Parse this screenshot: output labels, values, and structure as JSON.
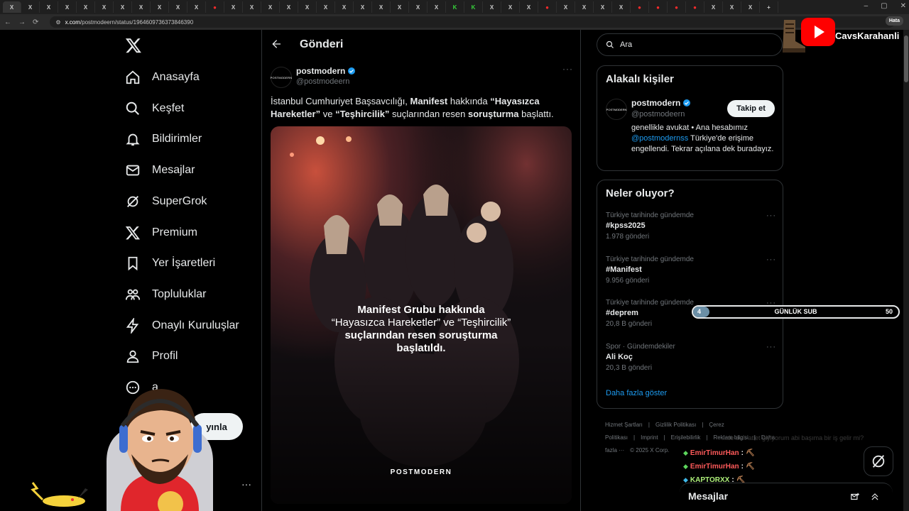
{
  "browser": {
    "url_host": "x.com",
    "url_path": "/postmodeern/status/1964609736373846390",
    "error_badge": "Hata"
  },
  "nav": {
    "items": [
      {
        "label": "Anasayfa",
        "icon": "home-icon"
      },
      {
        "label": "Keşfet",
        "icon": "search-icon"
      },
      {
        "label": "Bildirimler",
        "icon": "bell-icon"
      },
      {
        "label": "Mesajlar",
        "icon": "mail-icon"
      },
      {
        "label": "SuperGrok",
        "icon": "grok-icon"
      },
      {
        "label": "Premium",
        "icon": "x-icon"
      },
      {
        "label": "Yer İşaretleri",
        "icon": "bookmark-icon"
      },
      {
        "label": "Topluluklar",
        "icon": "communities-icon"
      },
      {
        "label": "Onaylı Kuruluşlar",
        "icon": "lightning-icon"
      },
      {
        "label": "Profil",
        "icon": "profile-icon"
      },
      {
        "label": "a",
        "icon": "more-circle-icon"
      }
    ],
    "post_button": "yınla",
    "account_tail": "li"
  },
  "main": {
    "title": "Gönderi",
    "post": {
      "author_name": "postmodern",
      "author_handle": "@postmodeern",
      "avatar_text": "POSTMODERN",
      "text_parts": [
        {
          "t": "İstanbul Cumhuriyet Başsavcılığı, ",
          "b": false
        },
        {
          "t": "Manifest",
          "b": true
        },
        {
          "t": " hakkında ",
          "b": false
        },
        {
          "t": "“Hayasızca Hareketler”",
          "b": true
        },
        {
          "t": " ve ",
          "b": false
        },
        {
          "t": "“Teşhircilik”",
          "b": true
        },
        {
          "t": " suçlarından resen ",
          "b": false
        },
        {
          "t": "soruşturma",
          "b": true
        },
        {
          "t": " başlattı.",
          "b": false
        }
      ],
      "image_caption_line1": "Manifest Grubu hakkında",
      "image_caption_line2": "“Hayasızca Hareketler” ve “Teşhircilik”",
      "image_caption_line3": "suçlarından resen soruşturma",
      "image_caption_line4": "başlatıldı.",
      "image_brand": "POSTMODERN"
    }
  },
  "right": {
    "search_placeholder": "Ara",
    "related": {
      "title": "Alakalı kişiler",
      "name": "postmodern",
      "handle": "@postmodeern",
      "avatar_text": "POSTMODERN",
      "follow_label": "Takip et",
      "bio_before": "genellikle avukat • Ana hesabımız ",
      "bio_mention": "@postmodernss",
      "bio_after": " Türkiye'de erişime engellendi. Tekrar açılana dek buradayız."
    },
    "trends": {
      "title": "Neler oluyor?",
      "items": [
        {
          "context": "Türkiye tarihinde gündemde",
          "name": "#kpss2025",
          "count": "1.978 gönderi"
        },
        {
          "context": "Türkiye tarihinde gündemde",
          "name": "#Manifest",
          "count": "9.956 gönderi"
        },
        {
          "context": "Türkiye tarihinde gündemde",
          "name": "#deprem",
          "count": "20,8 B gönderi"
        },
        {
          "context": "Spor · Gündemdekiler",
          "name": "Ali Koç",
          "count": "20,3 B gönderi"
        }
      ],
      "show_more": "Daha fazla göster"
    },
    "footer": [
      "Hizmet Şartları",
      "|",
      "Gizlilik Politikası",
      "|",
      "Çerez Politikası",
      "|",
      "Imprint",
      "|",
      "Erişilebilirlik",
      "|",
      "Reklam bilgisi",
      "|",
      "Daha fazla ···",
      "© 2025 X Corp."
    ]
  },
  "overlay": {
    "channel": "CavsKarahanli",
    "sub_goal": {
      "current": "4",
      "label": "GÜNLÜK SUB",
      "goal": "50",
      "fraction": 0.08
    },
    "chat": [
      {
        "user": "EmirTimurHan",
        "msg": ":",
        "color": "red"
      },
      {
        "user": "EmirTimurHan",
        "msg": ":",
        "color": "red"
      },
      {
        "user": "KAPTORXX",
        "msg": ":",
        "color": "green"
      },
      {
        "user": "KAPTORXX",
        "msg": ":",
        "color": "green"
      }
    ],
    "ghost_text": "...de den atlet giyiyorum abi başıma bir iş gelir mi?",
    "dm_title": "Mesajlar"
  }
}
